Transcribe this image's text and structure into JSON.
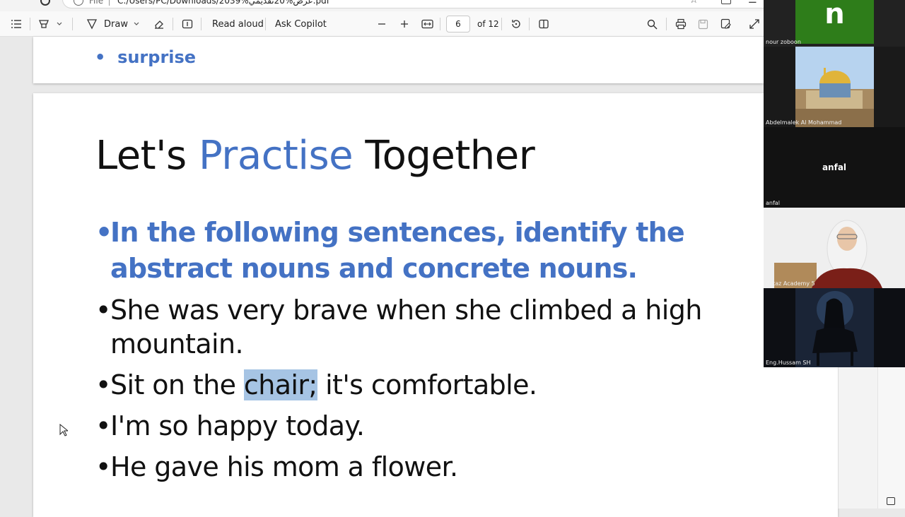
{
  "address_bar": {
    "scheme_label": "File",
    "url": "C:/Users/PC/Downloads/2039%عرض%20تقديمي.pdf"
  },
  "toolbar": {
    "contents_icon": "list-icon",
    "highlight_icon": "highlighter-icon",
    "draw_label": "Draw",
    "erase_icon": "eraser-icon",
    "textbox_icon": "text-box-icon",
    "read_aloud_label": "Read aloud",
    "ask_copilot_label": "Ask Copilot",
    "zoom_out_icon": "minus-icon",
    "zoom_in_icon": "plus-icon",
    "fit_icon": "fit-width-icon",
    "page_number": "6",
    "page_total": "of 12",
    "rotate_icon": "rotate-icon",
    "page_view_icon": "page-view-icon",
    "search_icon": "search-icon",
    "print_icon": "print-icon",
    "save_icon": "save-icon",
    "save_as_icon": "save-as-icon",
    "fullscreen_icon": "expand-icon"
  },
  "document": {
    "previous_page_bullet": "surprise",
    "title_part1": "Let's",
    "title_accent": "Practise",
    "title_part2": "Together",
    "instruction_line1": "In the following sentences, identify the",
    "instruction_line2": "abstract nouns and concrete nouns.",
    "sentence1_line1": "She was very brave when she climbed a high",
    "sentence1_line2": "mountain.",
    "sentence2_before": "Sit on the",
    "sentence2_highlight": "chair;",
    "sentence2_after": "it's comfortable.",
    "sentence3": "I'm so happy today.",
    "sentence4": "He gave his mom a flower.",
    "bullet_char": "•"
  },
  "participants": [
    {
      "name": "nour zoboon",
      "avatar_letter": "n"
    },
    {
      "name": "Abdelmalek Al Mohammad"
    },
    {
      "name": "anfal",
      "center_label": "anfal"
    },
    {
      "name": "Arkaz Academy 5"
    },
    {
      "name": "Eng.Hussam SH"
    }
  ],
  "colors": {
    "accent_blue": "#4472c4",
    "highlight": "#a6c4e4",
    "avatar_green": "#2e7d1a"
  }
}
